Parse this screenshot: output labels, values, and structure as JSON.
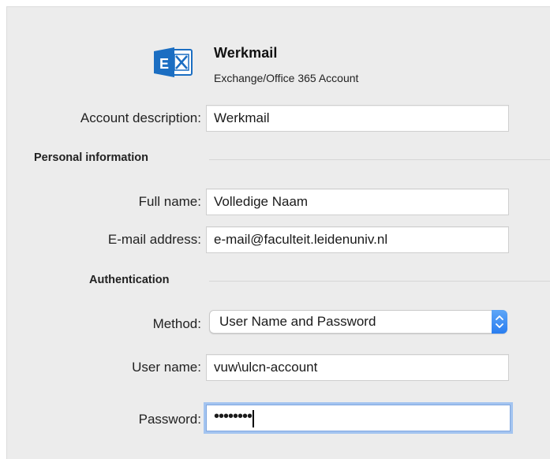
{
  "header": {
    "account_name": "Werkmail",
    "account_type": "Exchange/Office 365 Account",
    "icon": "exchange-icon"
  },
  "account_description": {
    "label": "Account description:",
    "value": "Werkmail"
  },
  "personal_information": {
    "title": "Personal information",
    "full_name": {
      "label": "Full name:",
      "value": "Volledige Naam"
    },
    "email": {
      "label": "E-mail address:",
      "value": "e-mail@faculteit.leidenuniv.nl"
    }
  },
  "authentication": {
    "title": "Authentication",
    "method": {
      "label": "Method:",
      "value": "User Name and Password"
    },
    "user_name": {
      "label": "User name:",
      "value": "vuw\\ulcn-account"
    },
    "password": {
      "label": "Password:",
      "masked_value": "••••••••"
    }
  },
  "colors": {
    "panel_bg": "#ececec",
    "focus_ring": "#a3c4f0",
    "select_accent": "#2a7ef0",
    "exchange_blue": "#1b6ec2"
  }
}
